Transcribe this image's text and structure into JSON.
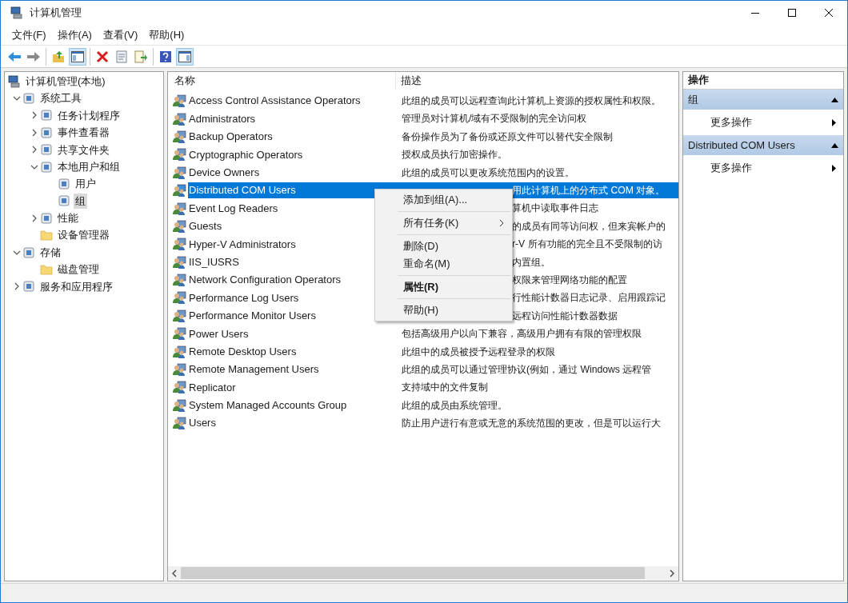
{
  "window": {
    "title": "计算机管理"
  },
  "menu": [
    "文件(F)",
    "操作(A)",
    "查看(V)",
    "帮助(H)"
  ],
  "toolbar": [
    [
      {
        "kind": "back",
        "on": false
      },
      {
        "kind": "forward",
        "on": false
      }
    ],
    [
      {
        "kind": "up",
        "on": false
      },
      {
        "kind": "tree",
        "on": true
      }
    ],
    [
      {
        "kind": "delete",
        "on": false
      },
      {
        "kind": "properties",
        "on": false
      },
      {
        "kind": "export",
        "on": false
      }
    ],
    [
      {
        "kind": "help",
        "on": false
      },
      {
        "kind": "pane",
        "on": true
      }
    ]
  ],
  "tree": [
    {
      "label": "计算机管理(本地)",
      "selected": false,
      "children": [
        {
          "label": "系统工具",
          "expanded": true,
          "selected": false,
          "children": [
            {
              "label": "任务计划程序",
              "expanded": false,
              "selected": false
            },
            {
              "label": "事件查看器",
              "expanded": false,
              "selected": false
            },
            {
              "label": "共享文件夹",
              "expanded": false,
              "selected": false
            },
            {
              "label": "本地用户和组",
              "expanded": true,
              "selected": false,
              "children": [
                {
                  "label": "用户",
                  "selected": false
                },
                {
                  "label": "组",
                  "selected": true
                }
              ]
            },
            {
              "label": "性能",
              "expanded": false,
              "selected": false
            },
            {
              "label": "设备管理器",
              "selected": false
            }
          ]
        },
        {
          "label": "存储",
          "expanded": true,
          "selected": false,
          "children": [
            {
              "label": "磁盘管理",
              "selected": false
            }
          ]
        },
        {
          "label": "服务和应用程序",
          "expanded": false,
          "selected": false
        }
      ]
    }
  ],
  "table": {
    "columns": [
      "名称",
      "描述"
    ],
    "rows": [
      {
        "name": "Access Control Assistance Operators",
        "description": "此组的成员可以远程查询此计算机上资源的授权属性和权限。",
        "selected": false,
        "covered": false
      },
      {
        "name": "Administrators",
        "description": "管理员对计算机/域有不受限制的完全访问权",
        "selected": false,
        "covered": false
      },
      {
        "name": "Backup Operators",
        "description": "备份操作员为了备份或还原文件可以替代安全限制",
        "selected": false,
        "covered": false
      },
      {
        "name": "Cryptographic Operators",
        "description": "授权成员执行加密操作。",
        "selected": false,
        "covered": false
      },
      {
        "name": "Device Owners",
        "description": "此组的成员可以更改系统范围内的设置。",
        "selected": false,
        "covered": false
      },
      {
        "name": "Distributed COM Users",
        "description": "用此计算机上的分布式 COM 对象。",
        "selected": true,
        "covered": true
      },
      {
        "name": "Event Log Readers",
        "description": "算机中读取事件日志",
        "selected": false,
        "covered": true
      },
      {
        "name": "Guests",
        "description": "的成员有同等访问权，但来宾帐户的",
        "selected": false,
        "covered": true
      },
      {
        "name": "Hyper-V Administrators",
        "description": "r-V 所有功能的完全且不受限制的访",
        "selected": false,
        "covered": true
      },
      {
        "name": "IIS_IUSRS",
        "description": "内置组。",
        "selected": false,
        "covered": true
      },
      {
        "name": "Network Configuration Operators",
        "description": "权限来管理网络功能的配置",
        "selected": false,
        "covered": true
      },
      {
        "name": "Performance Log Users",
        "description": "行性能计数器日志记录、启用跟踪记",
        "selected": false,
        "covered": true
      },
      {
        "name": "Performance Monitor Users",
        "description": "远程访问性能计数器数据",
        "selected": false,
        "covered": true
      },
      {
        "name": "Power Users",
        "description": "包括高级用户以向下兼容，高级用户拥有有限的管理权限",
        "selected": false,
        "covered": false
      },
      {
        "name": "Remote Desktop Users",
        "description": "此组中的成员被授予远程登录的权限",
        "selected": false,
        "covered": false
      },
      {
        "name": "Remote Management Users",
        "description": "此组的成员可以通过管理协议(例如，通过 Windows 远程管",
        "selected": false,
        "covered": false
      },
      {
        "name": "Replicator",
        "description": "支持域中的文件复制",
        "selected": false,
        "covered": false
      },
      {
        "name": "System Managed Accounts Group",
        "description": "此组的成员由系统管理。",
        "selected": false,
        "covered": false
      },
      {
        "name": "Users",
        "description": "防止用户进行有意或无意的系统范围的更改，但是可以运行大",
        "selected": false,
        "covered": false
      }
    ]
  },
  "context_menu": [
    {
      "kind": "item",
      "label": "添加到组(A)...",
      "bold": false,
      "submenu": false
    },
    {
      "kind": "separator"
    },
    {
      "kind": "item",
      "label": "所有任务(K)",
      "bold": false,
      "submenu": true
    },
    {
      "kind": "separator"
    },
    {
      "kind": "item",
      "label": "删除(D)",
      "bold": false,
      "submenu": false
    },
    {
      "kind": "item",
      "label": "重命名(M)",
      "bold": false,
      "submenu": false
    },
    {
      "kind": "separator"
    },
    {
      "kind": "item",
      "label": "属性(R)",
      "bold": true,
      "submenu": false
    },
    {
      "kind": "separator"
    },
    {
      "kind": "item",
      "label": "帮助(H)",
      "bold": false,
      "submenu": false
    }
  ],
  "actions": {
    "title": "操作",
    "sections": [
      {
        "title": "组",
        "expanded": true,
        "items": [
          "更多操作"
        ]
      },
      {
        "title": "Distributed COM Users",
        "expanded": true,
        "items": [
          "更多操作"
        ]
      }
    ]
  }
}
